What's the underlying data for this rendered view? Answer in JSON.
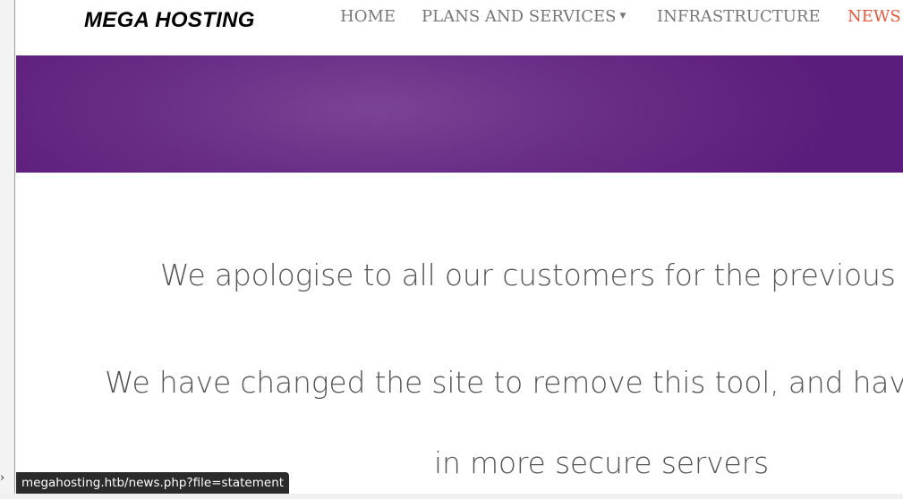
{
  "brand": {
    "logo_text": "MEGA HOSTING"
  },
  "nav": {
    "items": [
      {
        "label": "HOME",
        "active": false
      },
      {
        "label": "PLANS AND SERVICES",
        "active": false,
        "has_dropdown": true
      },
      {
        "label": "INFRASTRUCTURE",
        "active": false
      },
      {
        "label": "NEWS",
        "active": true
      }
    ]
  },
  "content": {
    "lines": [
      "We apologise to all our customers for the previous data",
      "We have changed the site to remove this tool, and have inve",
      "in more secure servers"
    ]
  },
  "status_bar": {
    "url": "megahosting.htb/news.php?file=statement"
  },
  "colors": {
    "accent": "#e4593a",
    "hero": "#6a2f88",
    "nav_text": "#777777"
  }
}
